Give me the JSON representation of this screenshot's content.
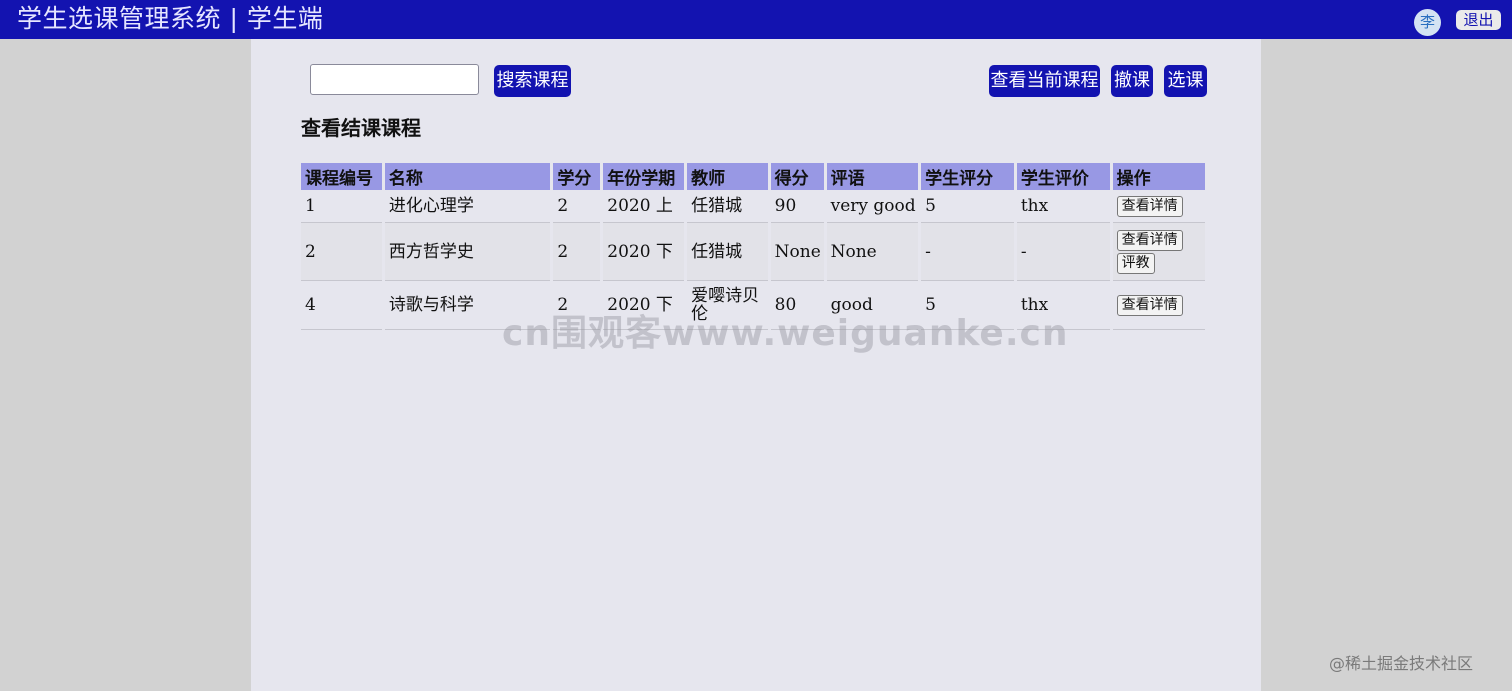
{
  "header": {
    "app_title": "学生选课管理系统 | 学生端",
    "avatar_text": "李",
    "logout_label": "退出"
  },
  "toolbar": {
    "search_value": "",
    "search_button": "搜索课程",
    "view_current_button": "查看当前课程",
    "withdraw_button": "撤课",
    "select_button": "选课"
  },
  "section_title": "查看结课课程",
  "table": {
    "columns": [
      "课程编号",
      "名称",
      "学分",
      "年份学期",
      "教师",
      "得分",
      "评语",
      "学生评分",
      "学生评价",
      "操作"
    ],
    "rows": [
      {
        "id": "1",
        "name": "进化心理学",
        "credit": "2",
        "term": "2020 上",
        "teacher": "任猎城",
        "score": "90",
        "comment": "very good",
        "rating": "5",
        "review": "thx",
        "actions": [
          "查看详情"
        ]
      },
      {
        "id": "2",
        "name": "西方哲学史",
        "credit": "2",
        "term": "2020 下",
        "teacher": "任猎城",
        "score": "None",
        "comment": "None",
        "rating": "-",
        "review": "-",
        "actions": [
          "查看详情",
          "评教"
        ]
      },
      {
        "id": "4",
        "name": "诗歌与科学",
        "credit": "2",
        "term": "2020 下",
        "teacher": "爱嘤诗贝伦",
        "score": "80",
        "comment": "good",
        "rating": "5",
        "review": "thx",
        "actions": [
          "查看详情"
        ]
      }
    ]
  },
  "watermark": "cn围观客www.weiguanke.cn",
  "corner_mark": "@稀土掘金技术社区"
}
